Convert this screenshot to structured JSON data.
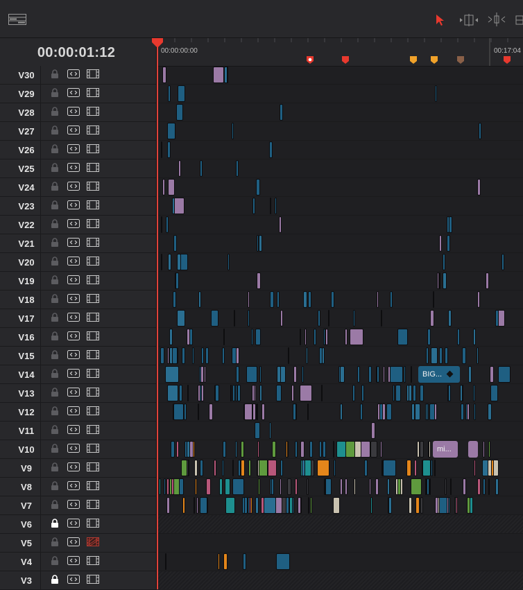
{
  "toolbar": {
    "layout_icon": "timeline-layout-icon",
    "tools": [
      "selection-arrow-icon",
      "trim-edit-icon",
      "dynamic-trim-icon",
      "blade-icon"
    ]
  },
  "header": {
    "timecode": "00:00:01:12"
  },
  "ruler": {
    "start_label": "00:00:00:00",
    "end_label": "00:17:04"
  },
  "colors": {
    "accent_red": "#e8392e",
    "clip_blue": "#1f5f82",
    "clip_purple": "#9b7aa6",
    "clip_orange": "#e4861b"
  },
  "markers": [
    {
      "color": "#e8392e",
      "type": "circle"
    },
    {
      "color": "#e8392e",
      "type": "flag"
    },
    {
      "color": "#f0a22a",
      "type": "flag"
    },
    {
      "color": "#f0a22a",
      "type": "flag"
    },
    {
      "color": "#8a6048",
      "type": "flag"
    },
    {
      "color": "#e8392e",
      "type": "flag"
    }
  ],
  "tracks": [
    {
      "label": "V30",
      "locked": false
    },
    {
      "label": "V29",
      "locked": false
    },
    {
      "label": "V28",
      "locked": false
    },
    {
      "label": "V27",
      "locked": false
    },
    {
      "label": "V26",
      "locked": false
    },
    {
      "label": "V25",
      "locked": false
    },
    {
      "label": "V24",
      "locked": false
    },
    {
      "label": "V23",
      "locked": false
    },
    {
      "label": "V22",
      "locked": false
    },
    {
      "label": "V21",
      "locked": false
    },
    {
      "label": "V20",
      "locked": false
    },
    {
      "label": "V19",
      "locked": false
    },
    {
      "label": "V18",
      "locked": false
    },
    {
      "label": "V17",
      "locked": false
    },
    {
      "label": "V16",
      "locked": false
    },
    {
      "label": "V15",
      "locked": false
    },
    {
      "label": "V14",
      "locked": false
    },
    {
      "label": "V13",
      "locked": false
    },
    {
      "label": "V12",
      "locked": false
    },
    {
      "label": "V11",
      "locked": false
    },
    {
      "label": "V10",
      "locked": false
    },
    {
      "label": "V9",
      "locked": false
    },
    {
      "label": "V8",
      "locked": false
    },
    {
      "label": "V7",
      "locked": false
    },
    {
      "label": "V6",
      "locked": true
    },
    {
      "label": "V5",
      "locked": false,
      "video_disabled": true
    },
    {
      "label": "V4",
      "locked": false
    },
    {
      "label": "V3",
      "locked": true
    }
  ],
  "named_clips": [
    {
      "track": "V14",
      "label": "BIG..."
    },
    {
      "track": "V10",
      "label": "mi..."
    }
  ]
}
